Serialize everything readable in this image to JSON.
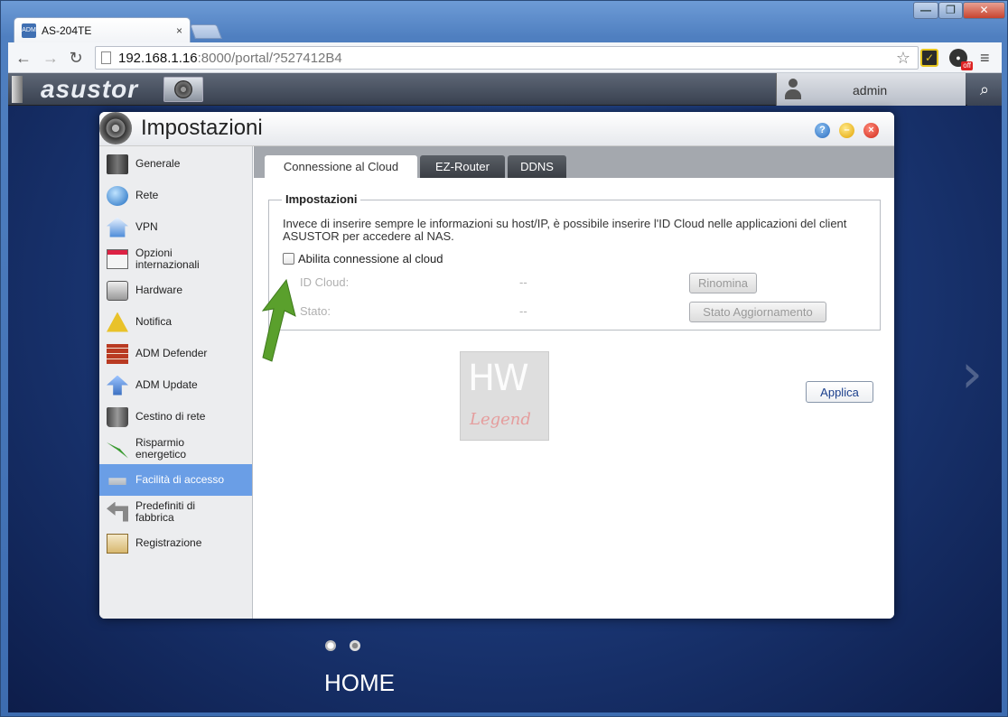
{
  "browser": {
    "tab_title": "AS-204TE",
    "tab_favicon": "ADM",
    "tab_close": "×",
    "url_host": "192.168.1.16",
    "url_path": ":8000/portal/?527412B4",
    "ext_off_badge": "off",
    "window_controls": {
      "minimize": "—",
      "maximize": "❐",
      "close": "✕"
    }
  },
  "adm": {
    "logo": "asustor",
    "username": "admin"
  },
  "window": {
    "title": "Impostazioni",
    "sidebar": [
      {
        "label": "Generale",
        "icon": "server-icon"
      },
      {
        "label": "Rete",
        "icon": "globe-icon"
      },
      {
        "label": "VPN",
        "icon": "vpn-house-icon"
      },
      {
        "label": "Opzioni internazionali",
        "icon": "calendar-clock-icon"
      },
      {
        "label": "Hardware",
        "icon": "hard-drive-icon"
      },
      {
        "label": "Notifica",
        "icon": "warning-icon"
      },
      {
        "label": "ADM Defender",
        "icon": "firewall-icon"
      },
      {
        "label": "ADM Update",
        "icon": "upload-arrow-icon"
      },
      {
        "label": "Cestino di rete",
        "icon": "trash-icon"
      },
      {
        "label": "Risparmio energetico",
        "icon": "lightning-icon"
      },
      {
        "label": "Facilità di accesso",
        "icon": "network-device-icon"
      },
      {
        "label": "Predefiniti di fabbrica",
        "icon": "undo-arrow-icon"
      },
      {
        "label": "Registrazione",
        "icon": "clipboard-icon"
      }
    ],
    "active_index": 10,
    "tabs": [
      "Connessione al Cloud",
      "EZ-Router",
      "DDNS"
    ],
    "settings": {
      "legend": "Impostazioni",
      "description": "Invece di inserire sempre le informazioni su host/IP, è possibile inserire l'ID Cloud nelle applicazioni del client ASUSTOR per accedere al NAS.",
      "checkbox_label": "Abilita connessione al cloud",
      "checkbox_checked": false,
      "id_cloud_label": "ID Cloud:",
      "id_cloud_value": "--",
      "stato_label": "Stato:",
      "stato_value": "--",
      "rinomina_button": "Rinomina",
      "stato_button": "Stato Aggiornamento"
    },
    "apply_button": "Applica"
  },
  "watermark": {
    "line1": "HW",
    "line2": "Legend"
  },
  "home": {
    "label": "HOME",
    "page_dots": 2,
    "active_dot": 0
  },
  "colors": {
    "active_sidebar": "#6a9ee6",
    "tabbar": "#a4a8ae",
    "arrow": "#5aa02c"
  }
}
